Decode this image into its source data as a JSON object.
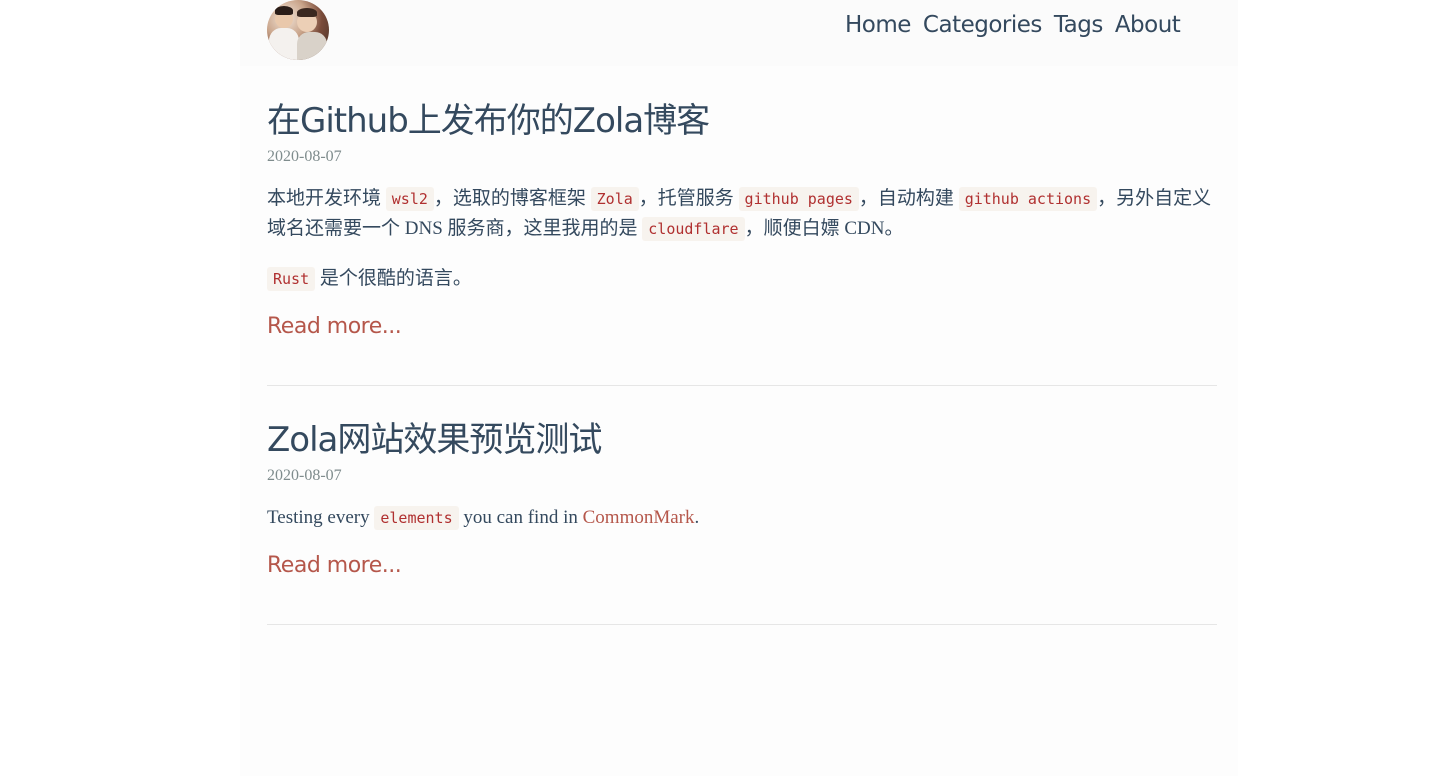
{
  "header": {
    "nav": [
      "Home",
      "Categories",
      "Tags",
      "About"
    ]
  },
  "posts": [
    {
      "title": "在Github上发布你的Zola博客",
      "date": "2020-08-07",
      "p1": {
        "t1": "本地开发环境",
        "c1": "wsl2",
        "t2": "，选取的博客框架",
        "c2": "Zola",
        "t3": "，托管服务",
        "c3": "github pages",
        "t4": "，自动构建",
        "c4": "github actions",
        "t5": "，另外自定义域名还需要一个 DNS 服务商，这里我用的是",
        "c5": "cloudflare",
        "t6": "，顺便白嫖 CDN。"
      },
      "p2": {
        "c1": "Rust",
        "t1": "是个很酷的语言。"
      },
      "read_more": "Read more..."
    },
    {
      "title": "Zola网站效果预览测试",
      "date": "2020-08-07",
      "p1": {
        "t1": "Testing every",
        "c1": "elements",
        "t2": "you can find in",
        "link": "CommonMark",
        "t3": "."
      },
      "read_more": "Read more..."
    }
  ]
}
